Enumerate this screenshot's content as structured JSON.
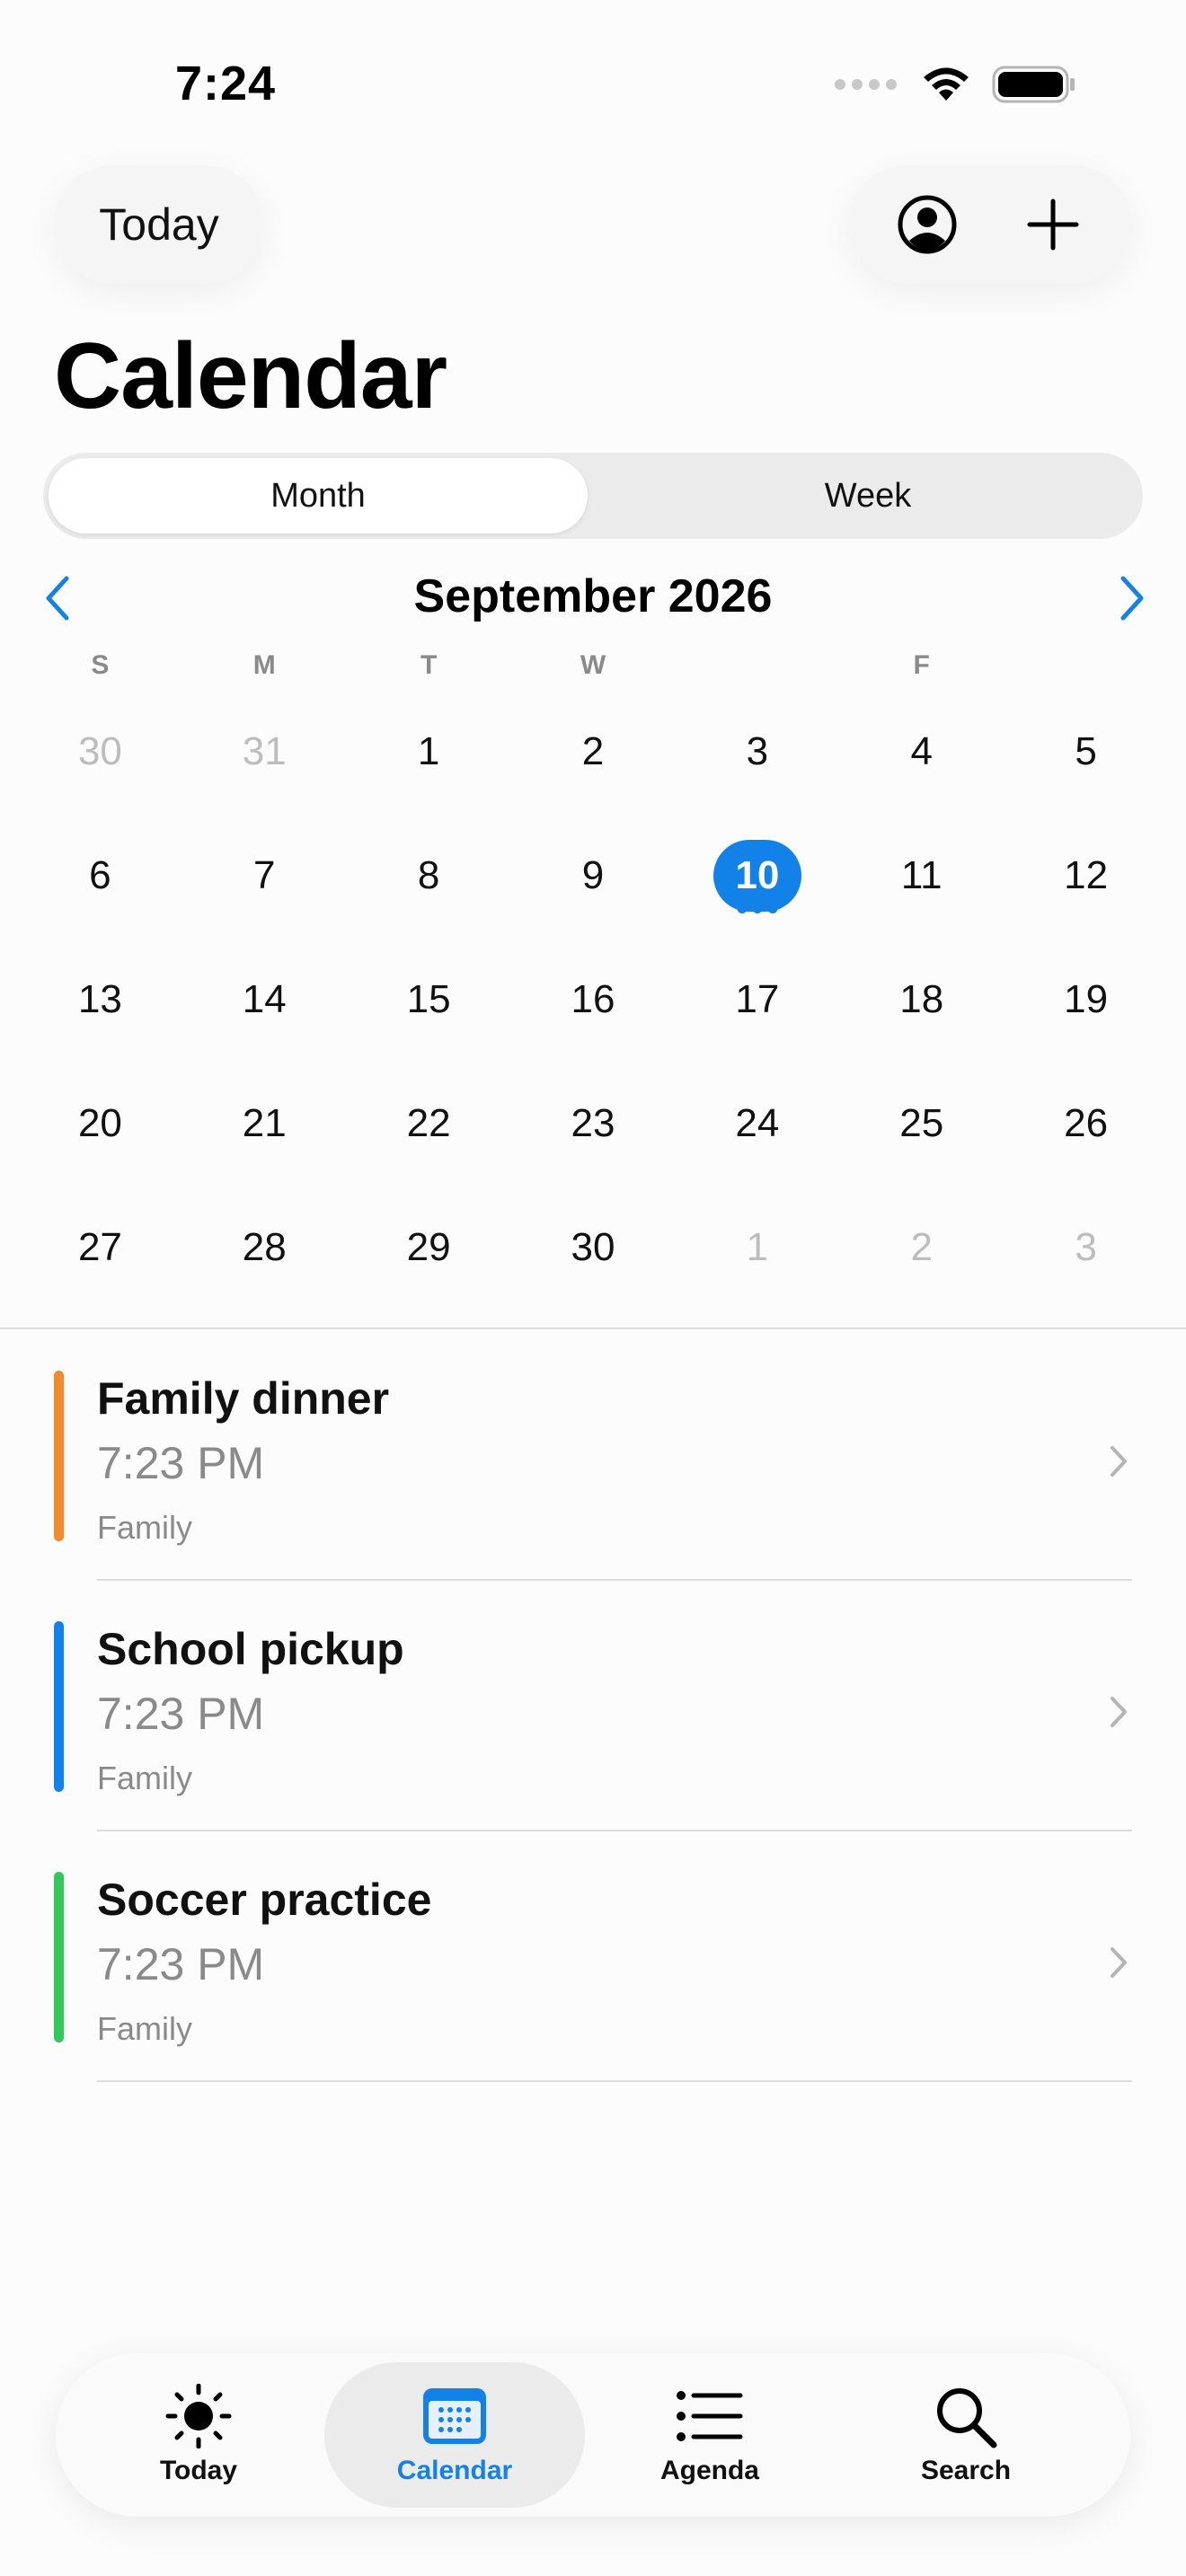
{
  "status_bar": {
    "time": "7:24"
  },
  "header": {
    "today_label": "Today",
    "title": "Calendar"
  },
  "segmented": {
    "month": "Month",
    "week": "Week"
  },
  "calendar": {
    "month_title": "September 2026",
    "weekdays": [
      "S",
      "M",
      "T",
      "W",
      "",
      "F",
      ""
    ],
    "weeks": [
      [
        "30",
        "31",
        "1",
        "2",
        "3",
        "4",
        "5"
      ],
      [
        "6",
        "7",
        "8",
        "9",
        "10",
        "11",
        "12"
      ],
      [
        "13",
        "14",
        "15",
        "16",
        "17",
        "18",
        "19"
      ],
      [
        "20",
        "21",
        "22",
        "23",
        "24",
        "25",
        "26"
      ],
      [
        "27",
        "28",
        "29",
        "30",
        "1",
        "2",
        "3"
      ]
    ],
    "selected_day": "10"
  },
  "events": [
    {
      "title": "Family dinner",
      "time": "7:23 PM",
      "calendar": "Family",
      "color": "#f28a2e"
    },
    {
      "title": "School pickup",
      "time": "7:23 PM",
      "calendar": "Family",
      "color": "#1282e8"
    },
    {
      "title": "Soccer practice",
      "time": "7:23 PM",
      "calendar": "Family",
      "color": "#34c759"
    }
  ],
  "tabbar": {
    "tabs": [
      {
        "label": "Today",
        "icon": "sun-icon"
      },
      {
        "label": "Calendar",
        "icon": "calendar-icon"
      },
      {
        "label": "Agenda",
        "icon": "list-icon"
      },
      {
        "label": "Search",
        "icon": "search-icon"
      }
    ],
    "active": "Calendar"
  },
  "colors": {
    "accent": "#1282e8",
    "text": "#111111",
    "secondary": "#8a8a8a"
  }
}
